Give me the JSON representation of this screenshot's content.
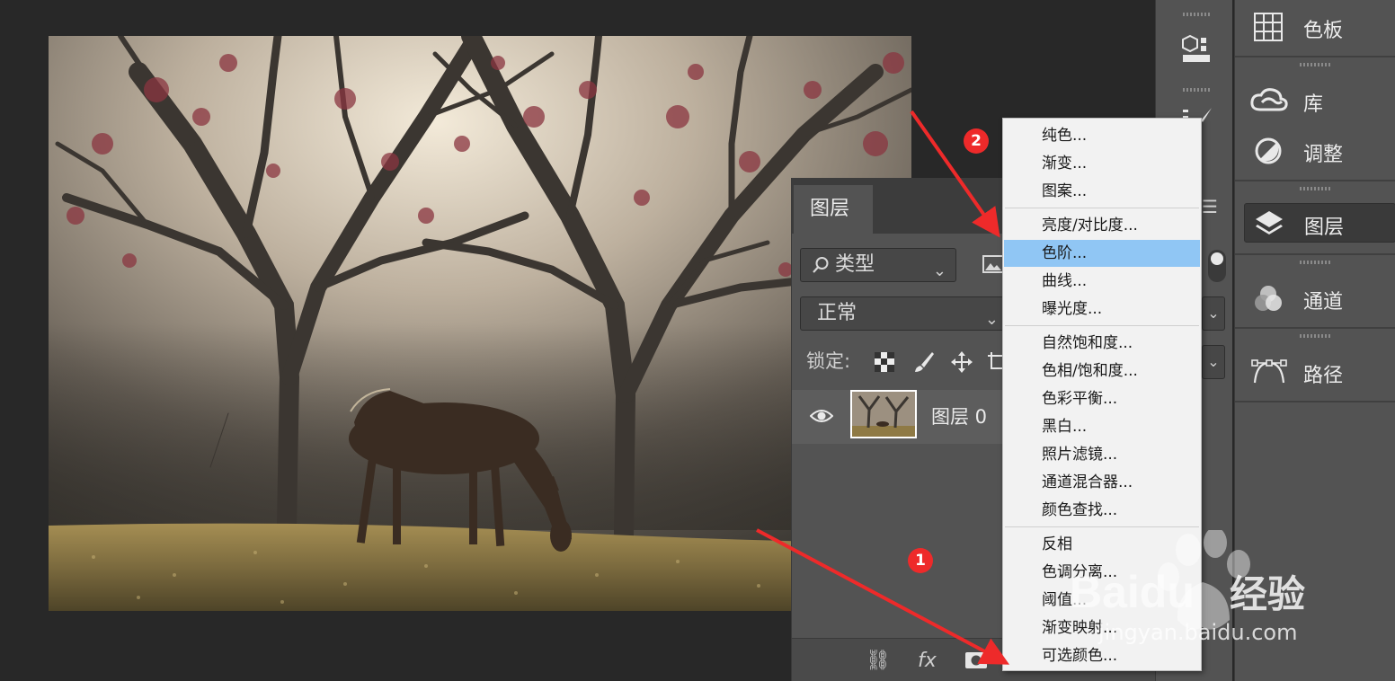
{
  "layers_panel": {
    "tab_label": "图层",
    "filter_label": "类型",
    "blend_mode": "正常",
    "lock_label": "锁定:",
    "layer_name": "图层 0",
    "bottom_fx": "fx"
  },
  "right_dock": {
    "items": [
      {
        "label": "色板",
        "icon": "swatches-grid-icon"
      },
      {
        "label": "库",
        "icon": "cc-libraries-icon"
      },
      {
        "label": "调整",
        "icon": "adjustments-icon"
      },
      {
        "label": "图层",
        "icon": "layers-icon",
        "active": true
      },
      {
        "label": "通道",
        "icon": "channels-icon"
      },
      {
        "label": "路径",
        "icon": "paths-icon"
      }
    ]
  },
  "adjust_menu": {
    "groups": [
      [
        "纯色...",
        "渐变...",
        "图案..."
      ],
      [
        "亮度/对比度...",
        "色阶...",
        "曲线...",
        "曝光度..."
      ],
      [
        "自然饱和度...",
        "色相/饱和度...",
        "色彩平衡...",
        "黑白...",
        "照片滤镜...",
        "通道混合器...",
        "颜色查找..."
      ],
      [
        "反相",
        "色调分离...",
        "阈值...",
        "渐变映射...",
        "可选颜色..."
      ]
    ],
    "highlighted": "色阶...",
    "highlight_color": "#90c6f4"
  },
  "annotations": {
    "badge_1": "1",
    "badge_2": "2",
    "color": "#ee2a2a"
  },
  "watermark": {
    "brand": "Baidu",
    "text": "经验",
    "url": "jingyan.baidu.com"
  }
}
